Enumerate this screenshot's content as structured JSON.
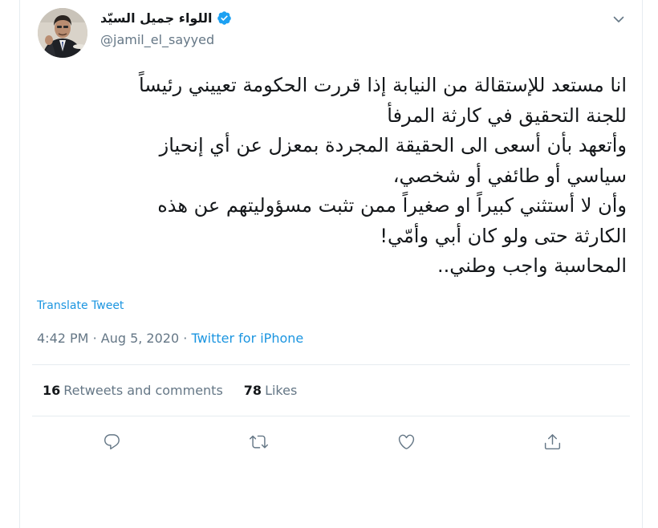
{
  "author": {
    "display_name": "اللواء جميل السيّد",
    "handle": "@jamil_el_sayyed",
    "verified": true
  },
  "tweet": {
    "lines": [
      "انا مستعد للإستقالة من النيابة إذا قررت الحكومة تعييني رئيساً",
      "للجنة التحقيق في كارثة المرفأ",
      "وأتعهد بأن أسعى الى الحقيقة المجردة بمعزل عن أي إنحياز",
      "سياسي أو طائفي أو شخصي،",
      "وأن لا أستثني كبيراً او صغيراً ممن تثبت مسؤوليتهم عن هذه",
      "الكارثة حتى ولو كان أبي وأمّي!",
      "المحاسبة واجب وطني.."
    ],
    "translate_label": "Translate Tweet",
    "time": "4:42 PM",
    "separator": "·",
    "date": "Aug 5, 2020",
    "source": "Twitter for iPhone"
  },
  "stats": {
    "retweets_count": "16",
    "retweets_label": "Retweets and comments",
    "likes_count": "78",
    "likes_label": "Likes"
  },
  "actions": [
    "reply-icon",
    "retweet-icon",
    "like-icon",
    "share-icon"
  ],
  "colors": {
    "link": "#1b95e0",
    "secondary_text": "#657786",
    "primary_text": "#14171a",
    "border": "#e6ecf0"
  }
}
